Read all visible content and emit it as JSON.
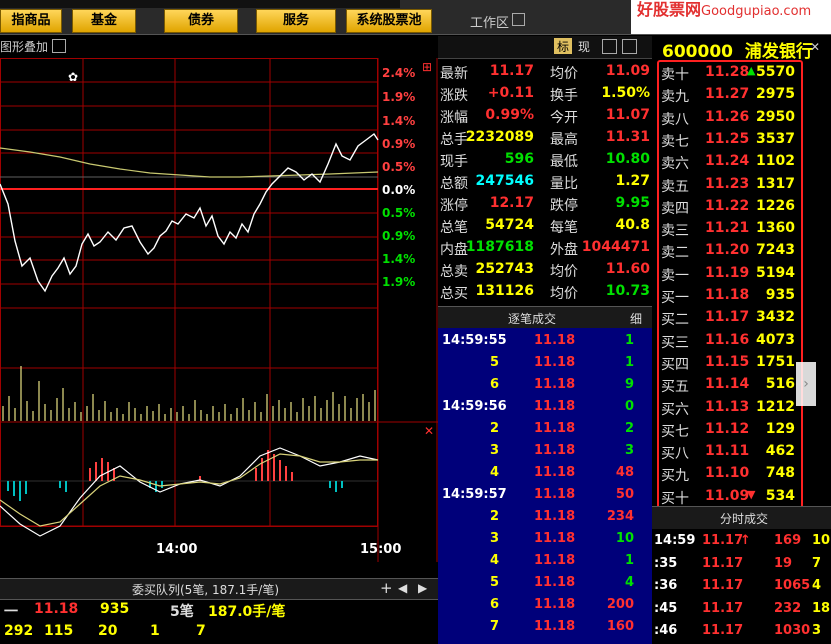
{
  "toolbar": {
    "buttons": [
      "指商品",
      "基金",
      "债券",
      "服务",
      "系统股票池"
    ],
    "workspace": "工作区",
    "watermark_site": "好股票网",
    "watermark_url": "Goodgupiao.com"
  },
  "chart": {
    "overlay_label": "图形叠加",
    "pct_labels_pos": [
      "2.4%",
      "1.9%",
      "1.4%",
      "0.9%",
      "0.5%"
    ],
    "pct_zero": "0.0%",
    "pct_labels_neg": [
      "0.5%",
      "0.9%",
      "1.4%",
      "1.9%"
    ],
    "time_labels": [
      "14:00",
      "15:00"
    ]
  },
  "header": {
    "tab_biao": "标",
    "tab_xian": "现",
    "code": "600000",
    "name": "浦发银行"
  },
  "quote": [
    {
      "l1": "最新",
      "v1": "11.17",
      "l2": "均价",
      "v2": "11.09"
    },
    {
      "l1": "涨跌",
      "v1": "+0.11",
      "l2": "换手",
      "v2": "1.50%"
    },
    {
      "l1": "涨幅",
      "v1": "0.99%",
      "l2": "今开",
      "v2": "11.07"
    },
    {
      "l1": "总手",
      "v1": "2232089",
      "l2": "最高",
      "v2": "11.31"
    },
    {
      "l1": "现手",
      "v1": "596",
      "l2": "最低",
      "v2": "10.80"
    },
    {
      "l1": "总额",
      "v1": "247546",
      "l2": "量比",
      "v2": "1.27"
    },
    {
      "l1": "涨停",
      "v1": "12.17",
      "l2": "跌停",
      "v2": "9.95"
    },
    {
      "l1": "总笔",
      "v1": "54724",
      "l2": "每笔",
      "v2": "40.8"
    },
    {
      "l1": "内盘",
      "v1": "1187618",
      "l2": "外盘",
      "v2": "1044471"
    },
    {
      "l1": "总卖",
      "v1": "252743",
      "l2": "均价",
      "v2": "11.60"
    },
    {
      "l1": "总买",
      "v1": "131126",
      "l2": "均价",
      "v2": "10.73"
    }
  ],
  "ticks": {
    "title": "逐笔成交",
    "detail": "细",
    "rows": [
      {
        "t": "14:59:55",
        "p": "11.18",
        "v": "1"
      },
      {
        "t": "5",
        "p": "11.18",
        "v": "1"
      },
      {
        "t": "6",
        "p": "11.18",
        "v": "9"
      },
      {
        "t": "14:59:56",
        "p": "11.18",
        "v": "0"
      },
      {
        "t": "2",
        "p": "11.18",
        "v": "2"
      },
      {
        "t": "3",
        "p": "11.18",
        "v": "3"
      },
      {
        "t": "4",
        "p": "11.18",
        "v": "48"
      },
      {
        "t": "14:59:57",
        "p": "11.18",
        "v": "50"
      },
      {
        "t": "2",
        "p": "11.18",
        "v": "234"
      },
      {
        "t": "3",
        "p": "11.18",
        "v": "10"
      },
      {
        "t": "4",
        "p": "11.18",
        "v": "1"
      },
      {
        "t": "5",
        "p": "11.18",
        "v": "4"
      },
      {
        "t": "6",
        "p": "11.18",
        "v": "200"
      },
      {
        "t": "7",
        "p": "11.18",
        "v": "160"
      }
    ]
  },
  "book": [
    {
      "l": "卖十",
      "p": "11.28",
      "v": "5570",
      "arrow": "▲"
    },
    {
      "l": "卖九",
      "p": "11.27",
      "v": "2975"
    },
    {
      "l": "卖八",
      "p": "11.26",
      "v": "2950"
    },
    {
      "l": "卖七",
      "p": "11.25",
      "v": "3537"
    },
    {
      "l": "卖六",
      "p": "11.24",
      "v": "1102"
    },
    {
      "l": "卖五",
      "p": "11.23",
      "v": "1317"
    },
    {
      "l": "卖四",
      "p": "11.22",
      "v": "1226"
    },
    {
      "l": "卖三",
      "p": "11.21",
      "v": "1360"
    },
    {
      "l": "卖二",
      "p": "11.20",
      "v": "7243"
    },
    {
      "l": "卖一",
      "p": "11.19",
      "v": "5194"
    },
    {
      "l": "买一",
      "p": "11.18",
      "v": "935"
    },
    {
      "l": "买二",
      "p": "11.17",
      "v": "3432"
    },
    {
      "l": "买三",
      "p": "11.16",
      "v": "4073"
    },
    {
      "l": "买四",
      "p": "11.15",
      "v": "1751"
    },
    {
      "l": "买五",
      "p": "11.14",
      "v": "516"
    },
    {
      "l": "买六",
      "p": "11.13",
      "v": "1212"
    },
    {
      "l": "买七",
      "p": "11.12",
      "v": "129"
    },
    {
      "l": "买八",
      "p": "11.11",
      "v": "462"
    },
    {
      "l": "买九",
      "p": "11.10",
      "v": "748"
    },
    {
      "l": "买十",
      "p": "11.09",
      "v": "534",
      "arrow": "▼"
    }
  ],
  "minute": {
    "title": "分时成交",
    "rows": [
      {
        "t": "14:59",
        "p": "11.17",
        "arrow": "↑",
        "v": "169",
        "n": "10"
      },
      {
        "t": ":35",
        "p": "11.17",
        "v": "19",
        "n": "7"
      },
      {
        "t": ":36",
        "p": "11.17",
        "v": "1065",
        "n": "4"
      },
      {
        "t": ":45",
        "p": "11.17",
        "v": "232",
        "n": "18"
      },
      {
        "t": ":46",
        "p": "11.17",
        "v": "1030",
        "n": "3"
      }
    ]
  },
  "queue": {
    "title": "委买队列(5笔, 187.1手/笔)",
    "plus": "+",
    "row1": {
      "l": "一",
      "p": "11.18",
      "v": "935",
      "c": "5笔",
      "a": "187.0手/笔"
    },
    "row2": [
      "292",
      "115",
      "20",
      "1",
      "7"
    ]
  },
  "colors": {
    "up": "#ff3030",
    "down": "#00e000",
    "yellow": "#ffff00",
    "cyan": "#00ffff",
    "grid": "#a00000"
  }
}
